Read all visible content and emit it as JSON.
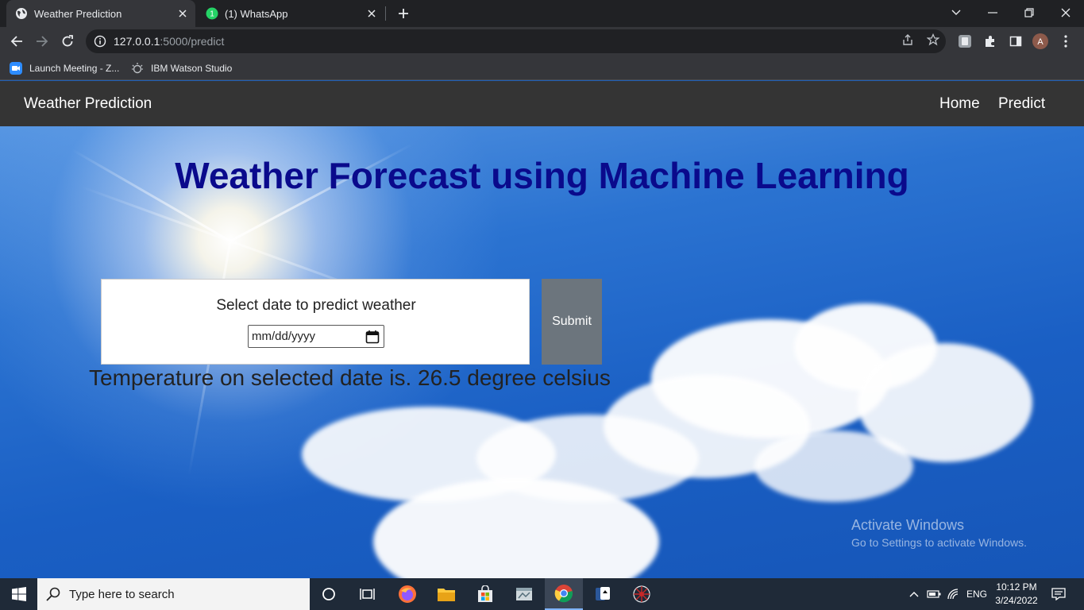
{
  "browser": {
    "tabs": [
      {
        "title": "Weather Prediction",
        "icon": "globe-icon",
        "active": true
      },
      {
        "title": "(1) WhatsApp",
        "icon": "whatsapp-icon",
        "badge": "1",
        "active": false
      }
    ],
    "address": {
      "host": "127.0.0.1",
      "rest": ":5000/predict"
    },
    "profile_initial": "A",
    "bookmarks": [
      {
        "label": "Launch Meeting - Z...",
        "icon": "zoom-icon"
      },
      {
        "label": "IBM Watson Studio",
        "icon": "watson-icon"
      }
    ]
  },
  "navbar": {
    "brand": "Weather Prediction",
    "links": [
      "Home",
      "Predict"
    ]
  },
  "main": {
    "heading": "Weather Forecast using Machine Learning",
    "form_label": "Select date to predict weather",
    "date_placeholder": "mm/dd/yyyy",
    "submit_label": "Submit",
    "result": "Temperature on selected date is. 26.5 degree celsius"
  },
  "watermark": {
    "line1": "Activate Windows",
    "line2": "Go to Settings to activate Windows."
  },
  "taskbar": {
    "search_placeholder": "Type here to search",
    "language": "ENG",
    "time": "10:12 PM",
    "date": "3/24/2022"
  },
  "colors": {
    "heading": "#0a0a8c",
    "navbar": "#343434",
    "submit": "#6c757d"
  }
}
